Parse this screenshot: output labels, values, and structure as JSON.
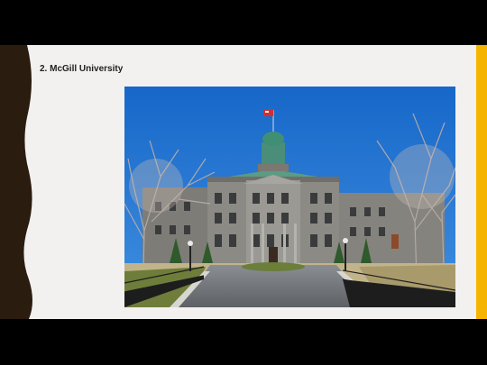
{
  "slide": {
    "title": "2. McGill University",
    "colors": {
      "background": "#f2f1ef",
      "left_band": "#2b1c10",
      "right_band": "#f4b400",
      "title_text": "#1f1f1f"
    }
  },
  "photo": {
    "subject": "campus building photo",
    "sky_color": "#1c6fd1",
    "dome_color": "#3f8f74",
    "flag_color": "#d32f2f"
  }
}
